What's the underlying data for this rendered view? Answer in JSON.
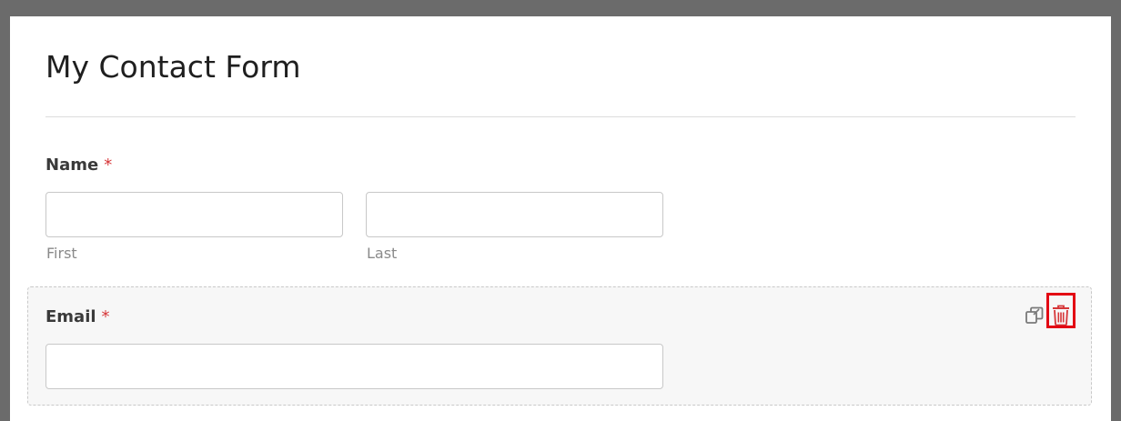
{
  "form": {
    "title": "My Contact Form"
  },
  "fields": {
    "name": {
      "label": "Name",
      "required_marker": "*",
      "first_sublabel": "First",
      "last_sublabel": "Last",
      "first_value": "",
      "last_value": ""
    },
    "email": {
      "label": "Email",
      "required_marker": "*",
      "value": ""
    }
  },
  "field_actions": {
    "duplicate_icon": "duplicate-icon",
    "delete_icon": "trash-icon"
  },
  "colors": {
    "required": "#d63638",
    "highlight": "#e30613",
    "delete_icon": "#d63638",
    "duplicate_icon": "#7a7a7a",
    "backdrop": "#6b6b6b"
  }
}
